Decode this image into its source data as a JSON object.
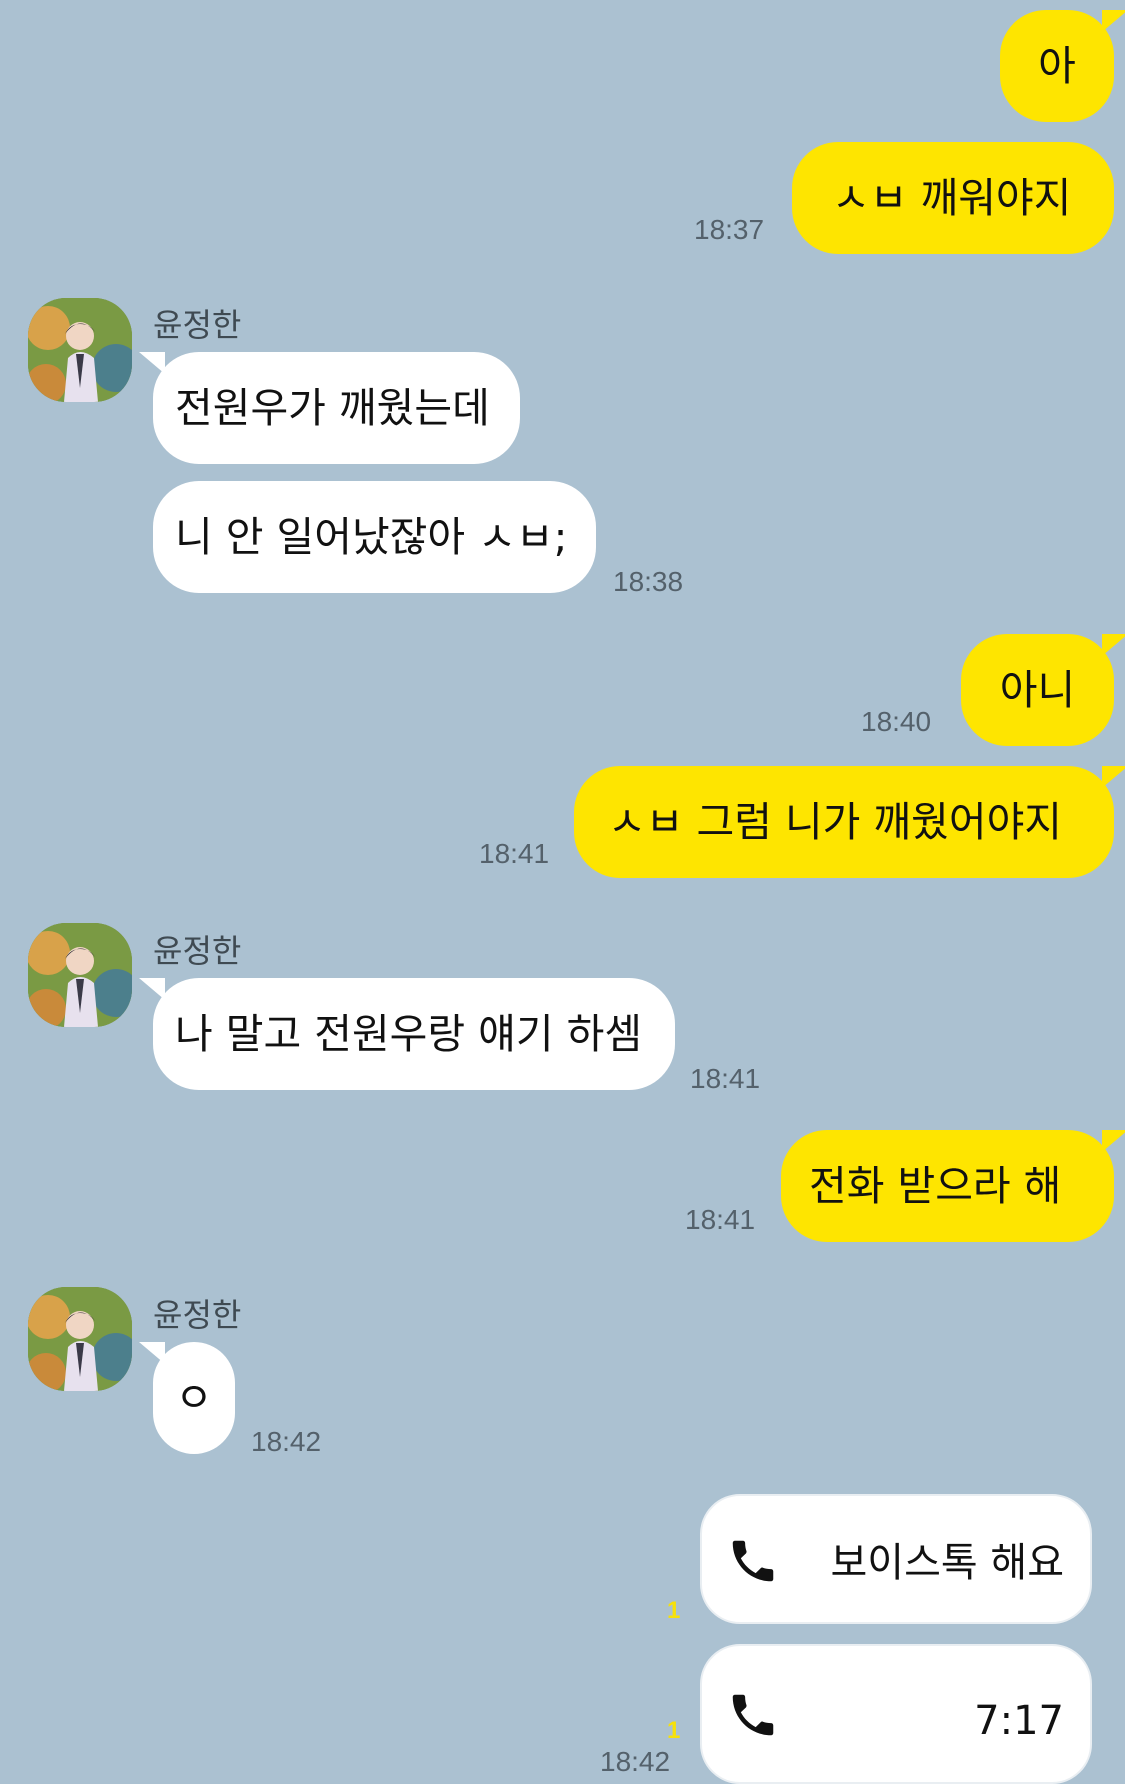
{
  "colors": {
    "background": "#abc1d1",
    "my_bubble": "#fee500",
    "their_bubble": "#ffffff",
    "unread": "#f7e10a"
  },
  "contact": {
    "name": "윤정한"
  },
  "messages": {
    "m1": {
      "text": "아"
    },
    "m2": {
      "text": "ㅅㅂ 깨워야지",
      "time": "18:37"
    },
    "m3": {
      "text": "전원우가 깨웠는데"
    },
    "m4": {
      "text": "니 안 일어났잖아 ㅅㅂ;",
      "time": "18:38"
    },
    "m5": {
      "text": "아니",
      "time": "18:40"
    },
    "m6": {
      "text": "ㅅㅂ 그럼 니가 깨웠어야지",
      "time": "18:41"
    },
    "m7": {
      "text": "나 말고 전원우랑 얘기 하셈",
      "time": "18:41"
    },
    "m8": {
      "text": "전화 받으라 해",
      "time": "18:41"
    },
    "m9": {
      "text": "ㅇ",
      "time": "18:42"
    }
  },
  "calls": {
    "c1": {
      "label": "보이스톡 해요",
      "unread": "1",
      "icon": "phone-icon"
    },
    "c2": {
      "label": "7:17",
      "unread": "1",
      "time": "18:42",
      "icon": "phone-icon"
    }
  }
}
